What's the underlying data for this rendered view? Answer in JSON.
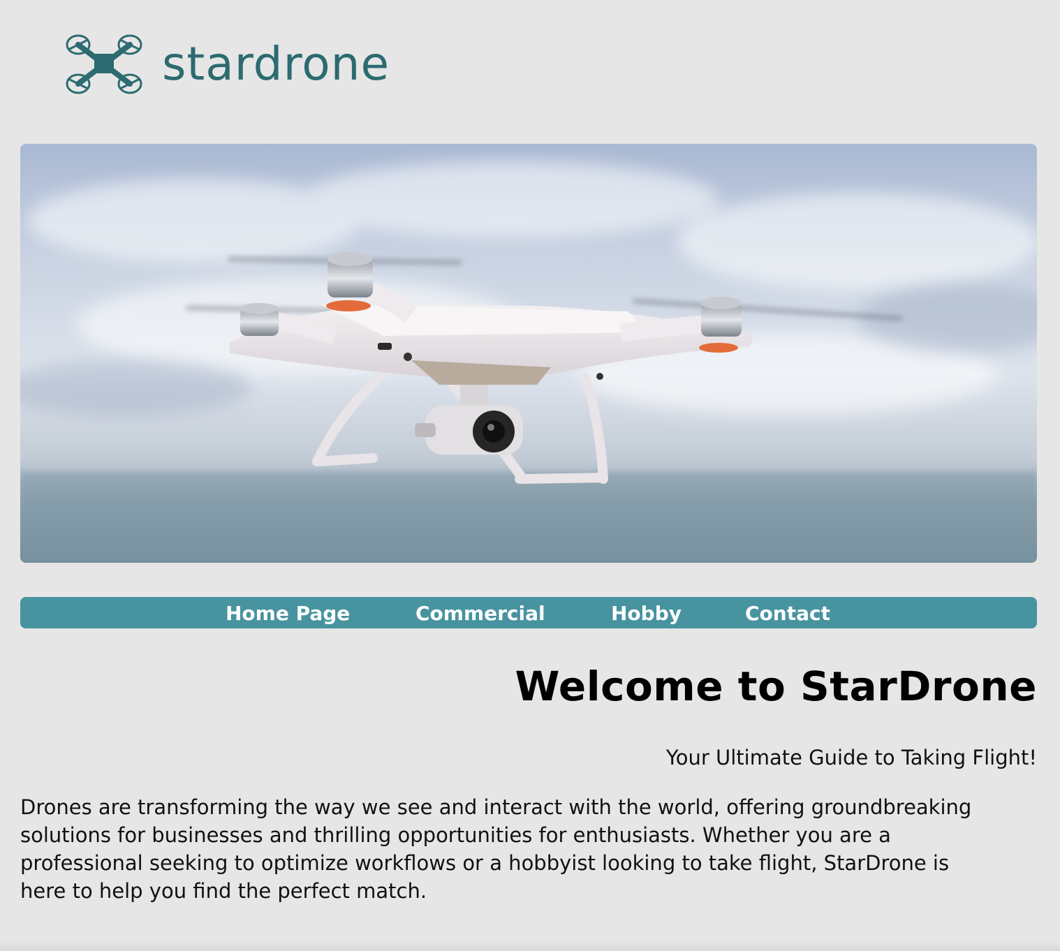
{
  "brand": {
    "name": "stardrone",
    "logo_icon": "quadcopter-icon",
    "color": "#2c6b70"
  },
  "hero": {
    "image": "white-quadcopter-drone-photo"
  },
  "nav": {
    "color": "#4793a0",
    "items": [
      {
        "label": "Home Page"
      },
      {
        "label": "Commercial"
      },
      {
        "label": "Hobby"
      },
      {
        "label": "Contact"
      }
    ]
  },
  "main": {
    "title": "Welcome to StarDrone",
    "tagline": "Your Ultimate Guide to Taking Flight!",
    "intro": "Drones are transforming the way we see and interact with the world, offering groundbreaking solutions for businesses and thrilling opportunities for enthusiasts. Whether you are a professional seeking to optimize workflows or a hobbyist looking to take flight, StarDrone is here to help you find the perfect match."
  }
}
